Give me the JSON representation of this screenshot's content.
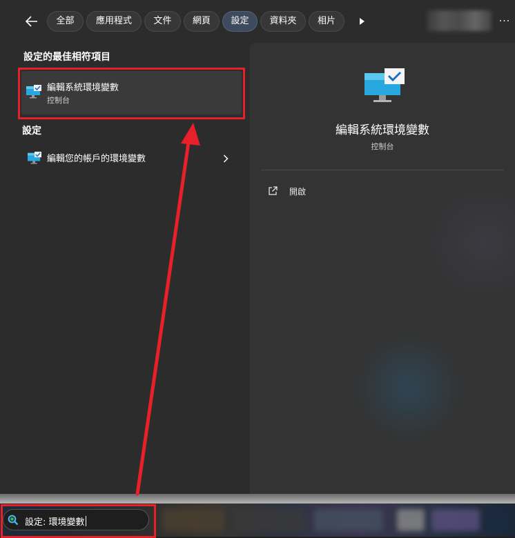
{
  "tabs": [
    {
      "label": "全部",
      "active": false
    },
    {
      "label": "應用程式",
      "active": false
    },
    {
      "label": "文件",
      "active": false
    },
    {
      "label": "網頁",
      "active": false
    },
    {
      "label": "設定",
      "active": true
    },
    {
      "label": "資料夾",
      "active": false
    },
    {
      "label": "相片",
      "active": false
    }
  ],
  "icons": {
    "back": "back-arrow-icon",
    "more_tabs": "play-icon",
    "overflow": "more-icon",
    "app": "monitor-check-icon",
    "chevron": "chevron-right-icon",
    "open": "open-external-icon",
    "search": "search-icon"
  },
  "overflow_label": "···",
  "left": {
    "best_match_heading": "設定的最佳相符項目",
    "best_match": {
      "name": "編輯系統環境變數",
      "subtitle": "控制台"
    },
    "settings_heading": "設定",
    "settings_items": [
      {
        "label": "編輯您的帳戶的環境變數"
      }
    ]
  },
  "preview": {
    "title": "編輯系統環境變數",
    "subtitle": "控制台",
    "actions": [
      {
        "label": "開啟"
      }
    ]
  },
  "taskbar": {
    "search_value": "設定: 環境變數"
  },
  "colors": {
    "panel": "#2c2c2c",
    "preview": "#333333",
    "active_tab": "#3e4a5e",
    "highlight": "#e8202a",
    "accent_blue": "#29a8e0"
  }
}
